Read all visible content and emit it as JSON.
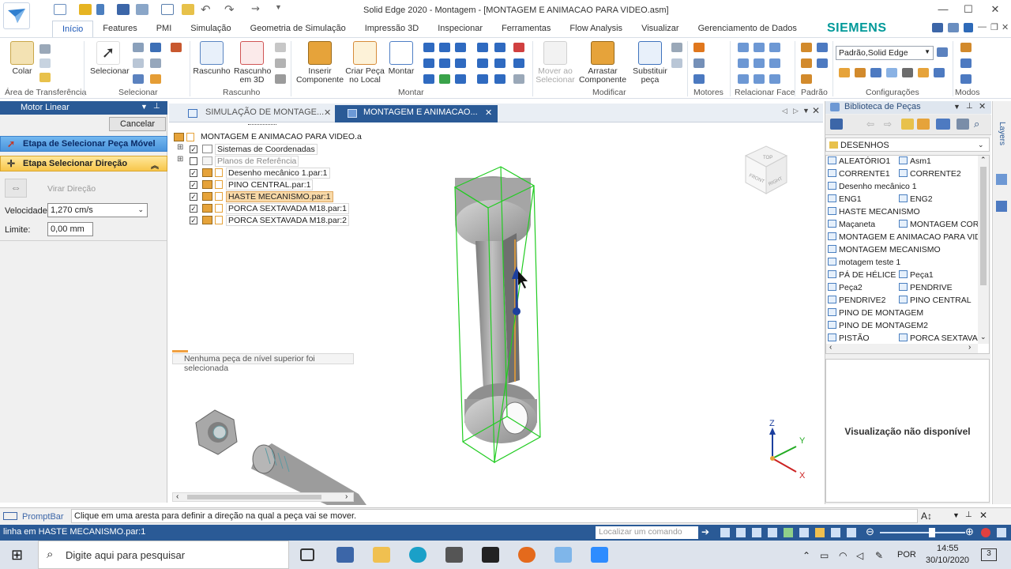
{
  "window": {
    "title": "Solid Edge 2020 - Montagem - [MONTAGEM E ANIMACAO PARA VIDEO.asm]",
    "controls": [
      "—",
      "☐",
      "✕"
    ]
  },
  "brand": "SIEMENS",
  "tabs": [
    "Início",
    "Features",
    "PMI",
    "Simulação",
    "Geometria de Simulação",
    "Impressão 3D",
    "Inspecionar",
    "Ferramentas",
    "Flow Analysis",
    "Visualizar",
    "Gerenciamento de Dados"
  ],
  "ribbon": {
    "colar": "Colar",
    "area_transferencia": "Área de Transferência",
    "selecionar": "Selecionar",
    "selecionar_group": "Selecionar",
    "rascunho": "Rascunho",
    "rascunho_3d_line1": "Rascunho",
    "rascunho_3d_line2": "em 3D",
    "rascunho_group": "Rascunho",
    "inserir_line1": "Inserir",
    "inserir_line2": "Componente",
    "criar_line1": "Criar Peça",
    "criar_line2": "no Local",
    "montar": "Montar",
    "montar_group": "Montar",
    "mover_line1": "Mover ao",
    "mover_line2": "Selecionar",
    "arrastar_line1": "Arrastar",
    "arrastar_line2": "Componente",
    "substituir_line1": "Substituir",
    "substituir_line2": "peça",
    "modificar_group": "Modificar",
    "motores_group": "Motores",
    "relacionar_group": "Relacionar Face",
    "padrao_combo": "Padrão,Solid Edge",
    "configuracoes_group": "Configurações",
    "padrao_group": "Padrão",
    "modos_group": "Modos"
  },
  "left_panel": {
    "title": "Motor Linear",
    "cancel": "Cancelar",
    "step1": "Etapa de Selecionar Peça Móvel",
    "step2": "Etapa Selecionar Direção",
    "virar": "Virar Direção",
    "velocidade_label": "Velocidade:",
    "velocidade_value": "1,270 cm/s",
    "limite_label": "Limite:",
    "limite_value": "0,00 mm"
  },
  "doc_tabs": [
    {
      "label": "SIMULAÇÃO DE MONTAGE...",
      "active": false
    },
    {
      "label": "MONTAGEM E ANIMACAO...",
      "active": true
    }
  ],
  "tree": {
    "root": "MONTAGEM E ANIMACAO PARA VIDEO.a",
    "items": [
      {
        "label": "Sistemas de Coordenadas",
        "checked": true,
        "style": "normal"
      },
      {
        "label": "Planos de Referência",
        "checked": false,
        "style": "muted"
      },
      {
        "label": "Desenho mecânico 1.par:1",
        "checked": true,
        "style": "normal"
      },
      {
        "label": "PINO CENTRAL.par:1",
        "checked": true,
        "style": "normal"
      },
      {
        "label": "HASTE MECANISMO.par:1",
        "checked": true,
        "style": "selected"
      },
      {
        "label": "PORCA SEXTAVADA M18.par:1",
        "checked": true,
        "style": "normal"
      },
      {
        "label": "PORCA SEXTAVADA M18.par:2",
        "checked": true,
        "style": "normal"
      }
    ],
    "footer": "Nenhuma peça de nível superior foi selecionada"
  },
  "axes": {
    "z": "Z",
    "y": "Y",
    "x": "X"
  },
  "viewcube": {
    "top": "TOP",
    "front": "FRONT",
    "right": "RIGHT"
  },
  "right_panel": {
    "title": "Biblioteca de Peças",
    "folder": "DESENHOS",
    "items": [
      [
        "ALEATÓRIO1",
        "Asm1"
      ],
      [
        "CORRENTE1",
        "CORRENTE2"
      ],
      [
        "Desenho mecânico 1",
        ""
      ],
      [
        "ENG1",
        "ENG2"
      ],
      [
        "HASTE MECANISMO",
        ""
      ],
      [
        "Maçaneta",
        "MONTAGEM COR"
      ],
      [
        "MONTAGEM E ANIMACAO PARA VID",
        ""
      ],
      [
        "MONTAGEM MECANISMO",
        ""
      ],
      [
        "motagem teste 1",
        ""
      ],
      [
        "PÁ DE HÉLICE",
        "Peça1"
      ],
      [
        "Peça2",
        "PENDRIVE"
      ],
      [
        "PENDRIVE2",
        "PINO CENTRAL"
      ],
      [
        "PINO DE MONTAGEM",
        ""
      ],
      [
        "PINO DE MONTAGEM2",
        ""
      ],
      [
        "PISTÃO",
        "PORCA SEXTAVA"
      ]
    ],
    "preview": "Visualização não disponível",
    "side_tab": "Layers"
  },
  "promptbar": {
    "label": "PromptBar",
    "message": "Clique em uma aresta para definir a direção na qual a peça vai se mover."
  },
  "status": {
    "text": "linha em HASTE MECANISMO.par:1",
    "search_placeholder": "Localizar um comando"
  },
  "taskbar": {
    "search": "Digite aqui para pesquisar",
    "lang": "POR",
    "time": "14:55",
    "date": "30/10/2020",
    "notif": "3"
  }
}
